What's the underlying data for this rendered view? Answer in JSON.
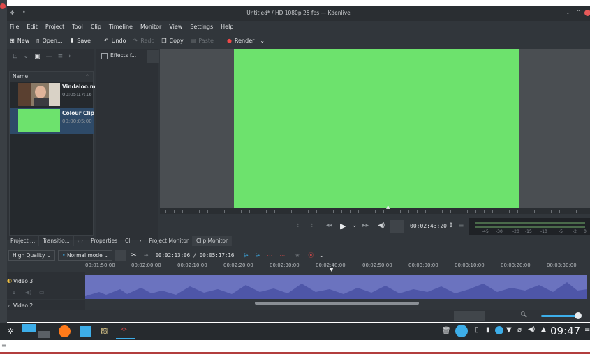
{
  "window": {
    "title": "Untitled* / HD 1080p 25 fps — Kdenlive"
  },
  "menu": [
    "File",
    "Edit",
    "Project",
    "Tool",
    "Clip",
    "Timeline",
    "Monitor",
    "View",
    "Settings",
    "Help"
  ],
  "toolbar": {
    "new": "New",
    "open": "Open...",
    "save": "Save",
    "undo": "Undo",
    "redo": "Redo",
    "copy": "Copy",
    "paste": "Paste",
    "render": "Render"
  },
  "bin": {
    "column": "Name",
    "clips": [
      {
        "name": "Vindaloo.m",
        "duration": "00:05:17:16"
      },
      {
        "name": "Colour Clip",
        "duration": "00:00:05:00"
      }
    ]
  },
  "effects": {
    "filter_label": "Effects f..."
  },
  "monitor": {
    "timecode": "00:02:43:20",
    "level_ticks": [
      "-45",
      "-30",
      "-20",
      "-15",
      "-10",
      "-5",
      "-2",
      "0"
    ]
  },
  "dock_tabs": [
    "Project ...",
    "Transitio...",
    "Properties",
    "Cli"
  ],
  "monitor_tabs": [
    "Project Monitor",
    "Clip Monitor"
  ],
  "timeline": {
    "quality": "High Quality",
    "mode": "Normal mode",
    "position": "00:02:13:06 / 00:05:17:16",
    "ruler": [
      "00:01:50:00",
      "00:02:00:00",
      "00:02:10:00",
      "00:02:20:00",
      "00:02:30:00",
      "00:02:40:00",
      "00:02:50:00",
      "00:03:00:00",
      "00:03:10:00",
      "00:03:20:00",
      "00:03:30:00"
    ],
    "tracks": [
      "Video 3",
      "Video 2"
    ]
  },
  "taskbar": {
    "clock": "09:47"
  },
  "colors": {
    "clip_green": "#6de26d",
    "waveform": "#6b73bf",
    "accent": "#3daee9",
    "render_dot": "#f04848"
  }
}
